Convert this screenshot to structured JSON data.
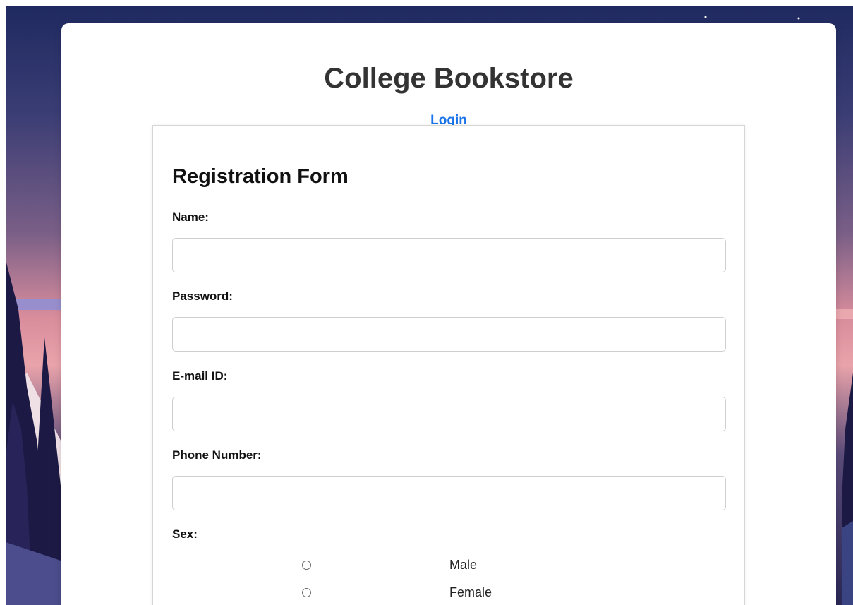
{
  "header": {
    "title": "College Bookstore",
    "login_label": "Login"
  },
  "form": {
    "heading": "Registration Form",
    "fields": [
      {
        "label": "Name:",
        "value": "",
        "placeholder": ""
      },
      {
        "label": "Password:",
        "value": "",
        "placeholder": ""
      },
      {
        "label": "E-mail ID:",
        "value": "",
        "placeholder": ""
      },
      {
        "label": "Phone Number:",
        "value": "",
        "placeholder": ""
      }
    ],
    "sex": {
      "label": "Sex:",
      "options": [
        "Male",
        "Female"
      ],
      "selected": null
    }
  },
  "colors": {
    "link": "#1a73e8",
    "title": "#333333",
    "background_top": "#1e2a5e",
    "background_mid": "#9c6f8f",
    "background_glow": "#e79aa4",
    "trees": "#1c1a44"
  }
}
